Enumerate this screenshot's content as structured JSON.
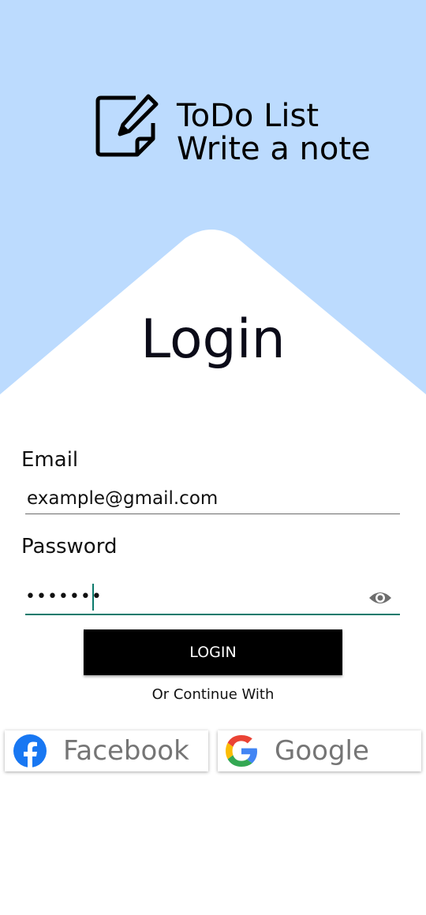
{
  "brand": {
    "logo_icon": "edit-note-icon",
    "title": "ToDo List",
    "subtitle": "Write a note"
  },
  "login": {
    "heading": "Login",
    "email_label": "Email",
    "email_value": "example@gmail.com",
    "password_label": "Password",
    "password_dots": "•••••••",
    "visibility_icon": "eye-icon",
    "button_label": "LOGIN",
    "or_text": "Or Continue With"
  },
  "social": {
    "facebook_label": "Facebook",
    "google_label": "Google"
  },
  "colors": {
    "hero_bg": "#bcdbfe",
    "accent": "#0a7a6c",
    "button_bg": "#000000",
    "facebook_blue": "#1877f2"
  }
}
